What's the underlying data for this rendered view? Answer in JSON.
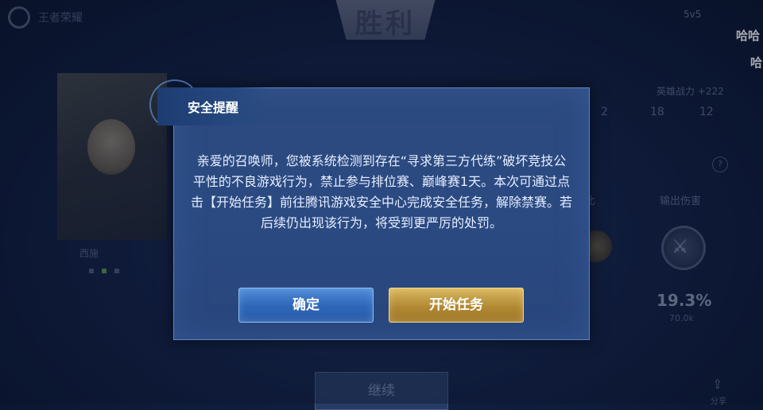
{
  "background": {
    "logo_text": "王者荣耀",
    "victory_text": "胜利",
    "mode_text": "5v5",
    "danmaku": [
      "哈哈",
      "哈"
    ],
    "hero_name": "西施",
    "stats": {
      "label_power": "英雄战力 +222",
      "val_a": "2",
      "val_b": "18",
      "val_c": "12",
      "label_ratio": "比",
      "label_damage": "输出伤害",
      "percent": "19.3%",
      "damage_value": "70.0k",
      "info": "?"
    },
    "continue_label": "继续",
    "share_label": "分享"
  },
  "dialog": {
    "title": "安全提醒",
    "body": "亲爱的召唤师，您被系统检测到存在“寻求第三方代练”破坏竞技公平性的不良游戏行为，禁止参与排位赛、巅峰赛1天。本次可通过点击【开始任务】前往腾讯游戏安全中心完成安全任务，解除禁赛。若后续仍出现该行为，将受到更严厉的处罚。",
    "confirm_label": "确定",
    "start_task_label": "开始任务"
  },
  "colors": {
    "dialog_bg": "#2b4a82",
    "confirm_button": "#2e66b8",
    "start_button": "#b28a34"
  }
}
